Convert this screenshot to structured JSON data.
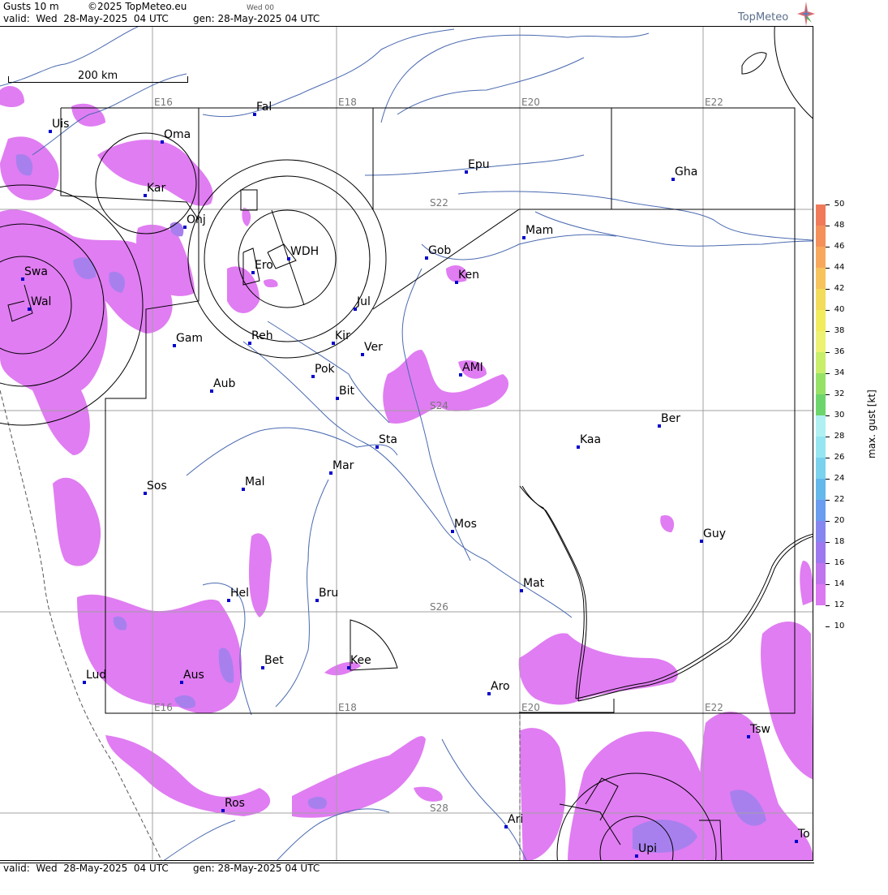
{
  "header": {
    "line1_left": "Gusts 10 m",
    "copyright": "©2025 TopMeteo.eu",
    "small_day": "Wed 00",
    "valid": "valid:  Wed  28-May-2025  04 UTC",
    "gen": "gen: 28-May-2025 04 UTC",
    "logo": "TopMeteo"
  },
  "footer": {
    "valid": "valid:  Wed  28-May-2025  04 UTC",
    "gen": "gen: 28-May-2025 04 UTC"
  },
  "scale": {
    "label": "200 km"
  },
  "grid_labels": [
    "E16",
    "E18",
    "E20",
    "E22",
    "S22",
    "S24",
    "S26",
    "S28"
  ],
  "places": [
    {
      "name": "Uis"
    },
    {
      "name": "Fal"
    },
    {
      "name": "Oma"
    },
    {
      "name": "Kar"
    },
    {
      "name": "Epu"
    },
    {
      "name": "Gha"
    },
    {
      "name": "Onj"
    },
    {
      "name": "Mam"
    },
    {
      "name": "Swa"
    },
    {
      "name": "Gob"
    },
    {
      "name": "WDH"
    },
    {
      "name": "Ero"
    },
    {
      "name": "Ken"
    },
    {
      "name": "Wal"
    },
    {
      "name": "Jul"
    },
    {
      "name": "Gam"
    },
    {
      "name": "Reh"
    },
    {
      "name": "Kir"
    },
    {
      "name": "Ver"
    },
    {
      "name": "Pok"
    },
    {
      "name": "AMI"
    },
    {
      "name": "Aub"
    },
    {
      "name": "Bit"
    },
    {
      "name": "Ber"
    },
    {
      "name": "Sta"
    },
    {
      "name": "Kaa"
    },
    {
      "name": "Mar"
    },
    {
      "name": "Sos"
    },
    {
      "name": "Mal"
    },
    {
      "name": "Mos"
    },
    {
      "name": "Guy"
    },
    {
      "name": "Mat"
    },
    {
      "name": "Hel"
    },
    {
      "name": "Bru"
    },
    {
      "name": "Bet"
    },
    {
      "name": "Kee"
    },
    {
      "name": "Lud"
    },
    {
      "name": "Aus"
    },
    {
      "name": "Aro"
    },
    {
      "name": "Tsw"
    },
    {
      "name": "Ros"
    },
    {
      "name": "Ari"
    },
    {
      "name": "Upi"
    },
    {
      "name": "To"
    }
  ],
  "legend": {
    "title": "max. gust [kt]",
    "ticks": [
      "50",
      "48",
      "46",
      "44",
      "42",
      "40",
      "38",
      "36",
      "34",
      "32",
      "30",
      "28",
      "26",
      "24",
      "22",
      "20",
      "18",
      "16",
      "14",
      "12",
      "10"
    ],
    "colors": {
      "50": "#f07a5a",
      "48": "#f5905a",
      "46": "#f8a85c",
      "44": "#f6c35c",
      "42": "#f2dc5a",
      "40": "#f2ec5c",
      "38": "#eef272",
      "36": "#c8ee6a",
      "34": "#96e266",
      "32": "#6cd66c",
      "30": "#b0f0f2",
      "28": "#96e6f2",
      "26": "#7ad2ee",
      "24": "#64b8ec",
      "22": "#6a9cf0",
      "20": "#8686f0",
      "18": "#9e78f0",
      "16": "#c074ee",
      "14": "#dc78f2",
      "12": "#ffffff"
    },
    "gust_fill": "#e07df2",
    "gust_fill_strong": "#a880ee"
  }
}
